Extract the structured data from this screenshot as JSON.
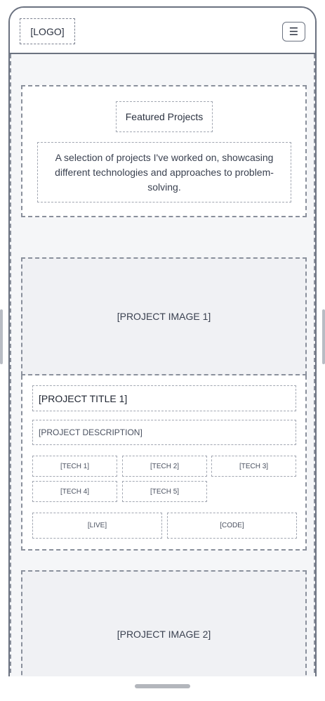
{
  "header": {
    "logo": "[LOGO]",
    "menu_icon": "hamburger-menu-icon",
    "menu_glyph": "☰"
  },
  "intro": {
    "title": "Featured Projects",
    "description": "A selection of projects I've worked on, showcasing different technologies and approaches to problem-solving."
  },
  "projects": [
    {
      "image": "[PROJECT IMAGE 1]",
      "title": "[PROJECT TITLE 1]",
      "description": "[PROJECT DESCRIPTION]",
      "tech": [
        "[TECH 1]",
        "[TECH 2]",
        "[TECH 3]",
        "[TECH 4]",
        "[TECH 5]"
      ],
      "live_label": "[LIVE]",
      "code_label": "[CODE]"
    },
    {
      "image": "[PROJECT IMAGE 2]"
    }
  ],
  "colors": {
    "border": "#6b7280",
    "dashed": "#8a909c",
    "image_bg": "#f0f1f4",
    "page_bg": "#f5f6f8"
  }
}
